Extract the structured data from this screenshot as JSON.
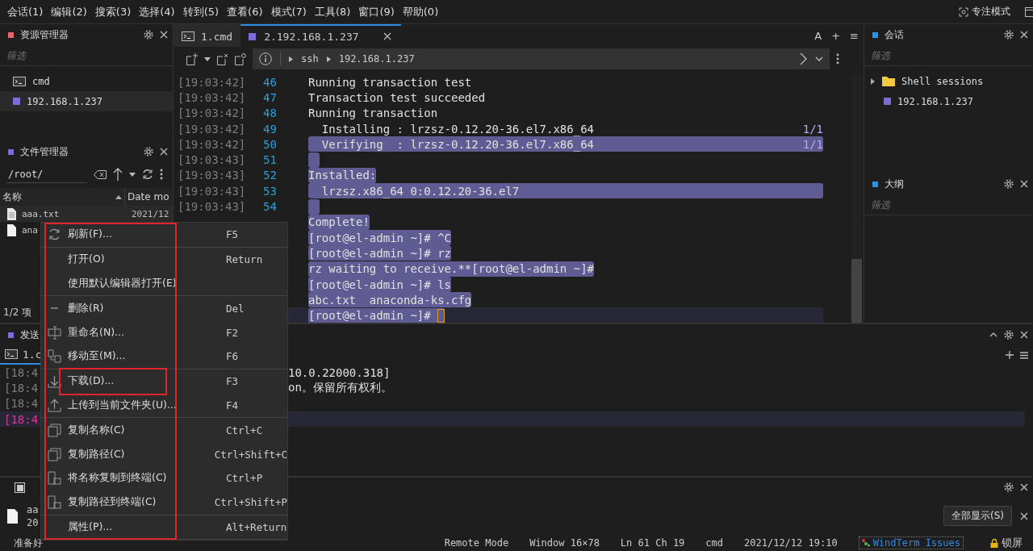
{
  "menubar": {
    "items": [
      "会话(1)",
      "编辑(2)",
      "搜索(3)",
      "选择(4)",
      "转到(5)",
      "查看(6)",
      "模式(7)",
      "工具(8)",
      "窗口(9)",
      "帮助(0)"
    ],
    "focus_mode": "专注模式"
  },
  "explorer": {
    "title": "资源管理器",
    "color": "#e8646e",
    "filter_placeholder": "筛选",
    "items": [
      {
        "kind": "cmd",
        "label": "cmd",
        "selected": false
      },
      {
        "kind": "ssh",
        "label": "192.168.1.237",
        "selected": true
      }
    ]
  },
  "file_manager": {
    "title": "文件管理器",
    "color": "#7b6cd9",
    "path": "/root/",
    "columns": [
      "名称",
      "Date mo"
    ],
    "rows": [
      {
        "kind": "text",
        "name": "aaa.txt",
        "date": "2021/12",
        "selected": true
      },
      {
        "kind": "blank",
        "name": "ana",
        "selected": false
      }
    ],
    "count": "1/2 项"
  },
  "tabs": [
    {
      "kind": "cmd",
      "label": "1.cmd",
      "selected": false
    },
    {
      "kind": "ssh",
      "label": "2.192.168.1.237",
      "selected": true
    }
  ],
  "tab_actions": [
    "A",
    "+",
    "≡"
  ],
  "breadcrumb": [
    "ssh",
    "192.168.1.237"
  ],
  "terminal": {
    "lines": [
      {
        "time": "[19:03:42]",
        "number": "46",
        "text": "Running transaction test",
        "selected": false
      },
      {
        "time": "[19:03:42]",
        "number": "47",
        "text": "Transaction test succeeded",
        "selected": false
      },
      {
        "time": "[19:03:42]",
        "number": "48",
        "text": "Running transaction",
        "selected": false
      },
      {
        "time": "[19:03:42]",
        "number": "49",
        "text": "  Installing : lrzsz-0.12.20-36.el7.x86_64",
        "count": "1/1",
        "selected": false
      },
      {
        "time": "[19:03:42]",
        "number": "50",
        "text": "  Verifying  : lrzsz-0.12.20-36.el7.x86_64",
        "count": "1/1",
        "selected": true
      },
      {
        "time": "[19:03:43]",
        "number": "51",
        "selected": true
      },
      {
        "time": "[19:03:43]",
        "number": "52",
        "text": "Installed:",
        "selected": true
      },
      {
        "time": "[19:03:43]",
        "number": "53",
        "text": "  lrzsz.x86_64 0:0.12.20-36.el7",
        "selected": true,
        "wide": true
      },
      {
        "time": "[19:03:43]",
        "number": "54",
        "selected": true
      },
      {
        "text": "Complete!",
        "selected": true
      },
      {
        "text": "[root@el-admin ~]# ^C",
        "selected": true
      },
      {
        "text": "[root@el-admin ~]# rz",
        "selected": true
      },
      {
        "text": "rz waiting to receive.**[root@el-admin ~]#",
        "selected": true
      },
      {
        "text": "[root@el-admin ~]# ls",
        "selected": true
      },
      {
        "text": "abc.txt  anaconda-ks.cfg",
        "selected": true
      },
      {
        "text": "[root@el-admin ~]# ",
        "selected": true,
        "current": true,
        "cursor": true
      }
    ]
  },
  "sessions": {
    "title": "会话",
    "color": "#2196f3",
    "filter_placeholder": "筛选",
    "tree": [
      {
        "kind": "folder",
        "label": "Shell sessions",
        "expanded": false
      },
      {
        "kind": "ssh",
        "label": "192.168.1.237"
      }
    ]
  },
  "outline": {
    "title": "大纲",
    "color": "#2196f3",
    "filter_placeholder": "筛选"
  },
  "send": {
    "title": "发送",
    "color": "#7b6cd9",
    "tabs": [
      {
        "label": "1.c",
        "selected": true
      }
    ],
    "lines": [
      {
        "time": "[18:4",
        "text": "10.0.22000.318]",
        "current": false
      },
      {
        "time": "[18:4",
        "text": "on。保留所有权利。",
        "current": false
      },
      {
        "time": "[18:4",
        "current": false
      },
      {
        "time": "[18:4",
        "current": true
      }
    ]
  },
  "transfer": {
    "file_name": "aa",
    "file_date": "20",
    "show_all_button": "全部显示(S)"
  },
  "status_bar": {
    "ready": "准备好",
    "items": [
      "Remote Mode",
      "Window 16×78",
      "Ln 61 Ch 19",
      "cmd",
      "2021/12/12 19:10"
    ],
    "link": "WindTerm Issues",
    "lock": "锁屏"
  },
  "context_menu": {
    "annotation_frame": true,
    "groups": [
      [
        {
          "kind": "refresh",
          "label": "刷新(F)...",
          "shortcut": "F5",
          "highlighted": false
        }
      ],
      [
        {
          "kind": "plain",
          "label": "打开(O)",
          "shortcut": "Return",
          "highlighted": false
        },
        {
          "kind": "plain",
          "label": "使用默认编辑器打开(E)",
          "highlighted": false
        }
      ],
      [
        {
          "kind": "delete",
          "label": "删除(R)",
          "shortcut": "Del",
          "highlighted": false
        },
        {
          "kind": "rename",
          "label": "重命名(N)...",
          "shortcut": "F2",
          "highlighted": false
        },
        {
          "kind": "move",
          "label": "移动至(M)...",
          "shortcut": "F6",
          "highlighted": false
        }
      ],
      [
        {
          "kind": "download",
          "label": "下载(D)...",
          "shortcut": "F3",
          "highlighted": true
        },
        {
          "kind": "upload",
          "label": "上传到当前文件夹(U)...",
          "shortcut": "F4",
          "highlighted": false
        }
      ],
      [
        {
          "kind": "copy",
          "label": "复制名称(C)",
          "shortcut": "Ctrl+C",
          "highlighted": false
        },
        {
          "kind": "copy",
          "label": "复制路径(C)",
          "shortcut": "Ctrl+Shift+C",
          "highlighted": false
        },
        {
          "kind": "to-terminal",
          "label": "将名称复制到终端(C)",
          "shortcut": "Ctrl+P",
          "highlighted": false
        },
        {
          "kind": "to-terminal",
          "label": "复制路径到终端(C)",
          "shortcut": "Ctrl+Shift+P",
          "highlighted": false
        }
      ],
      [
        {
          "kind": "plain",
          "label": "属性(P)...",
          "shortcut": "Alt+Return",
          "highlighted": false
        }
      ]
    ]
  }
}
